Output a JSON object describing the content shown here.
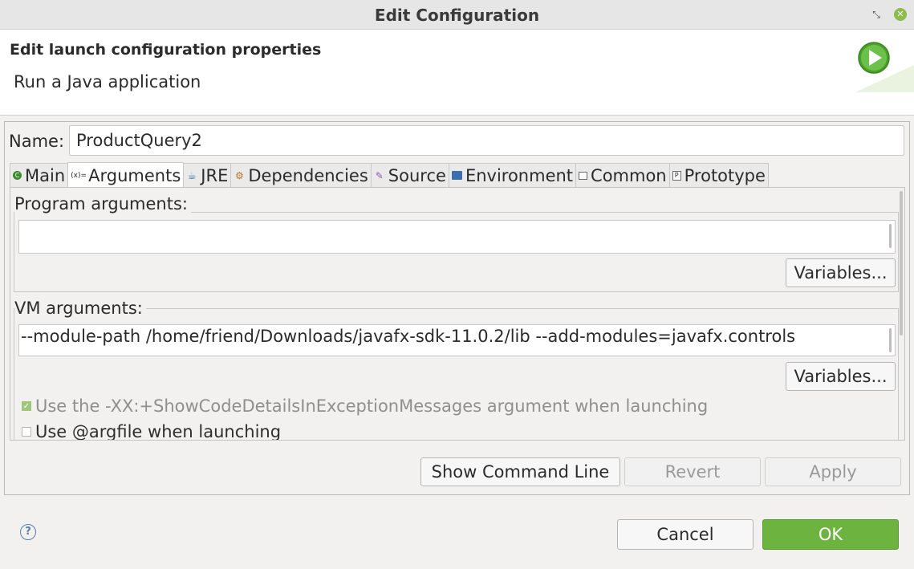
{
  "window": {
    "title": "Edit Configuration",
    "restore_icon": "restore-icon",
    "close_icon": "close-icon"
  },
  "header": {
    "title": "Edit launch configuration properties",
    "subtitle": "Run a Java application",
    "icon": "run-icon"
  },
  "name_field": {
    "label": "Name:",
    "value": "ProductQuery2"
  },
  "tabs": [
    {
      "label": "Main",
      "icon": "main-icon"
    },
    {
      "label": "Arguments",
      "icon": "arguments-icon",
      "active": true
    },
    {
      "label": "JRE",
      "icon": "jre-icon"
    },
    {
      "label": "Dependencies",
      "icon": "dependencies-icon"
    },
    {
      "label": "Source",
      "icon": "source-icon"
    },
    {
      "label": "Environment",
      "icon": "environment-icon"
    },
    {
      "label": "Common",
      "icon": "common-icon"
    },
    {
      "label": "Prototype",
      "icon": "prototype-icon"
    }
  ],
  "arguments": {
    "program_label": "Program arguments:",
    "program_value": "",
    "program_variables_button": "Variables...",
    "vm_label": "VM arguments:",
    "vm_value": "--module-path /home/friend/Downloads/javafx-sdk-11.0.2/lib --add-modules=javafx.controls",
    "vm_variables_button": "Variables...",
    "show_code_details_label": "Use the -XX:+ShowCodeDetailsInExceptionMessages argument when launching",
    "show_code_details_checked": true,
    "argfile_label": "Use @argfile when launching",
    "argfile_checked": false
  },
  "panel_buttons": {
    "show_command_line": "Show Command Line",
    "revert": "Revert",
    "apply": "Apply"
  },
  "dialog_buttons": {
    "cancel": "Cancel",
    "ok": "OK"
  },
  "help_icon": "help-icon",
  "colors": {
    "ok_button": "#6db33f",
    "titlebar": "#e6e6e6",
    "background": "#f2f1f0"
  }
}
